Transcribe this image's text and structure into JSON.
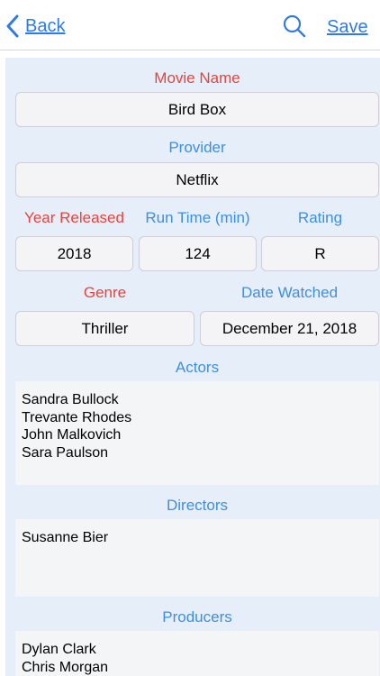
{
  "nav": {
    "back_label": "Back",
    "save_label": "Save"
  },
  "form": {
    "movie_name": {
      "label": "Movie Name",
      "value": "Bird Box"
    },
    "provider": {
      "label": "Provider",
      "value": "Netflix"
    },
    "year_released": {
      "label": "Year Released",
      "value": "2018"
    },
    "run_time": {
      "label": "Run Time (min)",
      "value": "124"
    },
    "rating": {
      "label": "Rating",
      "value": "R"
    },
    "genre": {
      "label": "Genre",
      "value": "Thriller"
    },
    "date_watched": {
      "label": "Date Watched",
      "value": "December 21, 2018"
    },
    "actors": {
      "label": "Actors",
      "names": [
        "Sandra Bullock",
        "Trevante Rhodes",
        "John Malkovich",
        "Sara Paulson"
      ]
    },
    "directors": {
      "label": "Directors",
      "names": [
        "Susanne Bier"
      ]
    },
    "producers": {
      "label": "Producers",
      "names": [
        "Dylan Clark",
        "Chris Morgan"
      ]
    }
  },
  "colors": {
    "accent": "#2f7be5",
    "required_label": "#e8433a",
    "optional_label": "#3d8fe0",
    "panel_bg": "#e6eef9"
  }
}
